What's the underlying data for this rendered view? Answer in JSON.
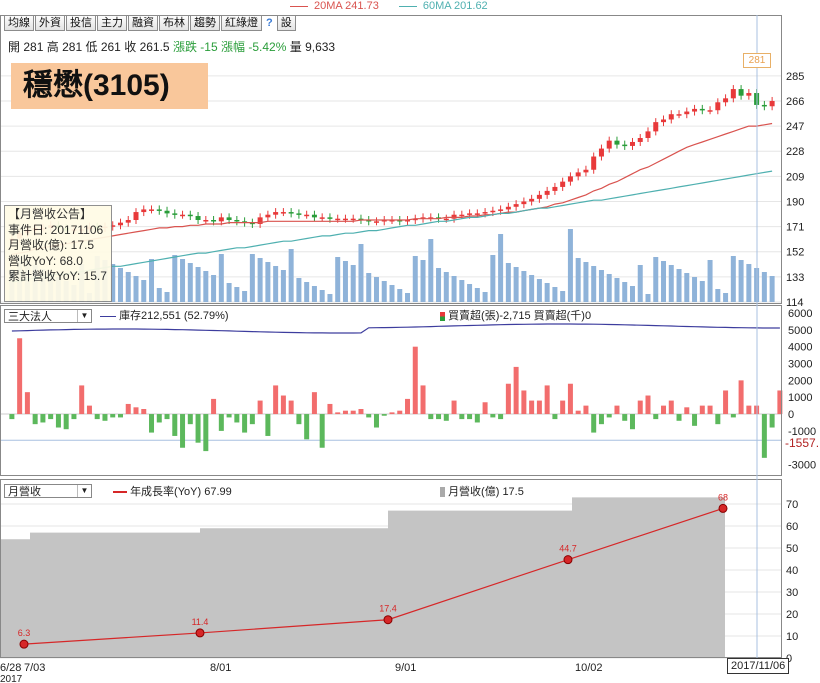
{
  "toolbar": {
    "buttons": [
      "均線",
      "外資",
      "投信",
      "主力",
      "融資",
      "布林",
      "趨勢",
      "紅綠燈"
    ],
    "help": "?",
    "settings": "設"
  },
  "ma_legend": {
    "ma20": "20MA 241.73",
    "ma60": "60MA 201.62",
    "ma20_color": "#d9534f",
    "ma60_color": "#4fb0b0"
  },
  "ohlc": {
    "open_label": "開",
    "open": "281",
    "high_label": "高",
    "high": "281",
    "low_label": "低",
    "low": "261",
    "close_label": "收",
    "close": "261.5",
    "chg_label": "漲跌",
    "chg": "-15",
    "pct_label": "漲幅",
    "pct": "-5.42%",
    "vol_label": "量",
    "vol": "9,633"
  },
  "title": "穩懋(3105)",
  "infobox": {
    "line1": "【月營收公告】",
    "line2": "事件日: 20171106",
    "line3": "月營收(億): 17.5",
    "line4": "營收YoY: 68.0",
    "line5": "累計營收YoY: 15.7"
  },
  "price_label": "281",
  "mid_panel": {
    "select": "三大法人",
    "inv_legend": "庫存212,551 (52.79%)",
    "buysell_legend": "買賣超(張)-2,715 買賣超(千)0",
    "last_value": "-1557."
  },
  "bottom_panel": {
    "select": "月營收",
    "yoy_legend": "年成長率(YoY) 67.99",
    "rev_legend": "月營收(億) 17.5"
  },
  "date_label": "2017/11/06",
  "colors": {
    "up": "#e8393a",
    "down": "#2a9d3a",
    "vol": "#8fb3d9",
    "inv_line": "#3d3d9e",
    "yoy_line": "#d62728",
    "rev_area": "#c4c4c4",
    "grid": "#e6e6e6"
  },
  "chart_data": [
    {
      "type": "candlestick",
      "title": "穩懋(3105)",
      "yticks": [
        "114",
        "133",
        "152",
        "171",
        "190",
        "209",
        "228",
        "247",
        "266",
        "285"
      ],
      "ylim": [
        114,
        300
      ],
      "close": [
        162,
        166,
        168,
        170,
        170,
        172,
        170,
        168,
        169,
        169,
        171,
        170,
        171,
        172,
        174,
        176,
        182,
        184,
        184,
        183,
        181,
        180,
        180,
        179,
        176,
        176,
        175,
        178,
        176,
        175,
        174,
        173,
        178,
        180,
        182,
        182,
        181,
        180,
        180,
        178,
        178,
        177,
        177,
        177,
        177,
        176,
        175,
        175,
        176,
        176,
        175,
        176,
        177,
        178,
        178,
        177,
        177,
        180,
        180,
        181,
        181,
        182,
        183,
        184,
        186,
        188,
        190,
        192,
        195,
        198,
        201,
        205,
        209,
        212,
        214,
        224,
        230,
        236,
        233,
        232,
        235,
        238,
        243,
        250,
        252,
        256,
        256,
        258,
        260,
        259,
        259,
        265,
        268,
        275,
        270,
        272,
        263,
        262,
        266
      ],
      "ma20": [
        150,
        151,
        152,
        154,
        155,
        156,
        157,
        158,
        159,
        160,
        161,
        162,
        163,
        164,
        165,
        166,
        167,
        168,
        169,
        170,
        170,
        171,
        171,
        172,
        172,
        173,
        173,
        173,
        174,
        174,
        174,
        174,
        174,
        175,
        175,
        175,
        175,
        175,
        175,
        175,
        175,
        175,
        175,
        175,
        175,
        176,
        176,
        176,
        176,
        176,
        176,
        176,
        177,
        177,
        177,
        177,
        178,
        178,
        178,
        179,
        179,
        180,
        180,
        181,
        182,
        182,
        183,
        184,
        185,
        186,
        188,
        189,
        191,
        193,
        195,
        198,
        200,
        203,
        205,
        208,
        211,
        214,
        216,
        219,
        222,
        225,
        228,
        231,
        233,
        235,
        237,
        239,
        241,
        243,
        245,
        247,
        247,
        248,
        249
      ],
      "ma60": [
        129,
        130,
        131,
        132,
        133,
        134,
        135,
        135,
        136,
        137,
        138,
        139,
        140,
        141,
        141,
        142,
        143,
        144,
        145,
        146,
        147,
        148,
        149,
        150,
        151,
        151,
        152,
        153,
        154,
        155,
        155,
        156,
        157,
        158,
        159,
        160,
        160,
        161,
        162,
        163,
        164,
        164,
        165,
        166,
        166,
        167,
        168,
        168,
        169,
        170,
        171,
        172,
        172,
        173,
        174,
        175,
        175,
        176,
        177,
        178,
        178,
        179,
        180,
        181,
        181,
        182,
        183,
        184,
        185,
        185,
        186,
        187,
        188,
        189,
        190,
        191,
        191,
        192,
        193,
        194,
        195,
        196,
        197,
        198,
        199,
        200,
        201,
        202,
        203,
        204,
        205,
        206,
        207,
        208,
        209,
        210,
        211,
        212,
        213
      ],
      "volume_label": "量"
    },
    {
      "type": "bar",
      "title": "三大法人",
      "series": [
        {
          "name": "買賣超(張)",
          "values": [
            -300,
            4500,
            1300,
            -600,
            -500,
            -300,
            -800,
            -900,
            -300,
            1700,
            500,
            -300,
            -400,
            -200,
            -200,
            600,
            400,
            300,
            -1100,
            -500,
            -300,
            -1300,
            -2000,
            -600,
            -1700,
            -2200,
            900,
            -1000,
            -200,
            -500,
            -1100,
            -600,
            800,
            -1300,
            1700,
            1100,
            800,
            -600,
            -1500,
            1300,
            -2000,
            600,
            100,
            200,
            200,
            300,
            -200,
            -800,
            -100,
            100,
            200,
            900,
            4000,
            1700,
            -300,
            -300,
            -400,
            800,
            -300,
            -300,
            -500,
            700,
            -200,
            -300,
            1800,
            2800,
            1400,
            800,
            800,
            1700,
            -300,
            800,
            1800,
            200,
            500,
            -1100,
            -600,
            -200,
            500,
            -400,
            -900,
            800,
            1100,
            -300,
            500,
            800,
            -400,
            400,
            -700,
            500,
            500,
            -600,
            1400,
            -200,
            2000,
            500,
            500,
            -2600,
            -800,
            1400
          ]
        }
      ],
      "inventory_name": "庫存",
      "yticks": [
        "-3000",
        "-1000",
        "0",
        "1000",
        "2000",
        "3000",
        "4000",
        "5000",
        "6000"
      ]
    },
    {
      "type": "line",
      "title": "月營收",
      "x": [
        "6/28",
        "7/03",
        "8/01",
        "9/01",
        "10/02",
        "11/06"
      ],
      "series": [
        {
          "name": "年成長率(YoY)",
          "values": [
            6.3,
            11.4,
            17.4,
            44.7,
            68
          ]
        }
      ],
      "points_labels": [
        "6.3",
        "11.4",
        "17.4",
        "44.7",
        "68"
      ],
      "xticks": [
        "6/28",
        "7/03",
        "8/01",
        "9/01",
        "10/02"
      ],
      "year_label": "2017",
      "yticks": [
        "0",
        "10",
        "20",
        "30",
        "40",
        "50",
        "60",
        "70"
      ],
      "ylim": [
        0,
        75
      ]
    }
  ]
}
